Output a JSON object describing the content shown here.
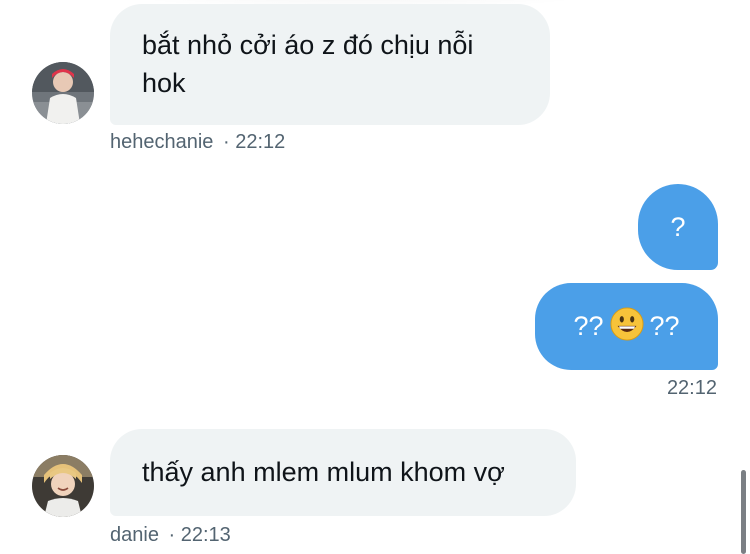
{
  "messages": [
    {
      "direction": "incoming",
      "avatar": "avatar-hehechanie",
      "text": "bắt nhỏ cởi áo z đó chịu nỗi hok",
      "meta_user": "hehechanie",
      "meta_time": "· 22:12"
    },
    {
      "direction": "outgoing",
      "text": "?"
    },
    {
      "direction": "outgoing",
      "text_before": "??",
      "emoji": "grinning-face-emoji",
      "text_after": "??",
      "meta_time": "22:12"
    },
    {
      "direction": "incoming",
      "avatar": "avatar-danie",
      "text": "thấy anh mlem mlum khom vợ",
      "meta_user": "danie",
      "meta_time": "· 22:13"
    }
  ],
  "colors": {
    "incoming_bubble": "#eff3f4",
    "outgoing_bubble": "#4b9fe8",
    "meta_text": "#536471"
  }
}
